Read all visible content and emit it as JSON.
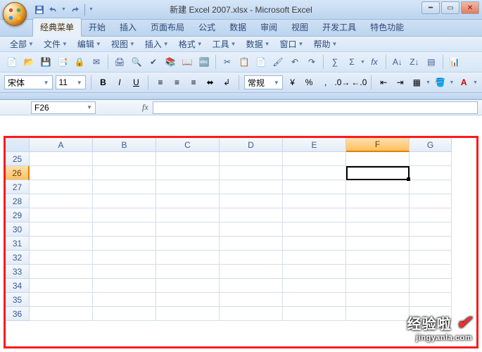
{
  "title": "新建 Excel 2007.xlsx - Microsoft Excel",
  "tabs": [
    "经典菜单",
    "开始",
    "插入",
    "页面布局",
    "公式",
    "数据",
    "审阅",
    "视图",
    "开发工具",
    "特色功能"
  ],
  "classic_menu": {
    "items": [
      "全部",
      "文件",
      "编辑",
      "视图",
      "插入",
      "格式",
      "工具",
      "数据",
      "窗口",
      "帮助"
    ]
  },
  "format_row": {
    "font_name": "宋体",
    "font_size": "11",
    "number_format": "常规"
  },
  "namebox": {
    "value": "F26"
  },
  "grid": {
    "columns": [
      "A",
      "B",
      "C",
      "D",
      "E",
      "F",
      "G"
    ],
    "first_row": 25,
    "last_row": 36,
    "active_cell": {
      "row": 26,
      "col": "F"
    }
  },
  "watermark": {
    "line1": "经验啦",
    "line2": "jingyanla.com"
  }
}
